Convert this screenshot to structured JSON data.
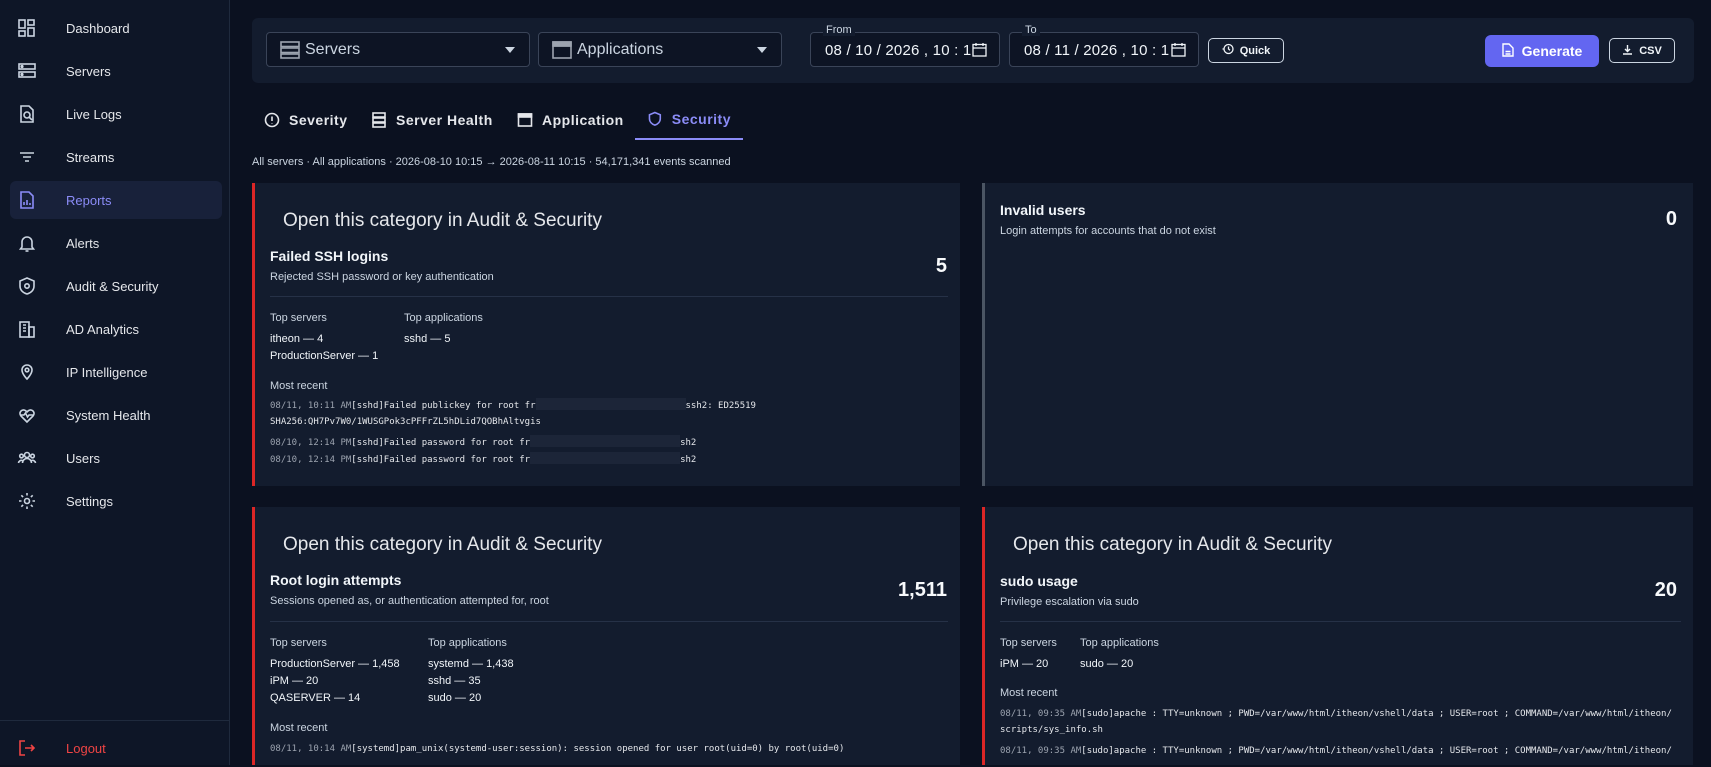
{
  "sidebar": {
    "items": [
      {
        "label": "Dashboard",
        "icon": "dashboard-icon"
      },
      {
        "label": "Servers",
        "icon": "servers-icon"
      },
      {
        "label": "Live Logs",
        "icon": "live-logs-icon"
      },
      {
        "label": "Streams",
        "icon": "streams-icon"
      },
      {
        "label": "Reports",
        "icon": "reports-icon",
        "active": true
      },
      {
        "label": "Alerts",
        "icon": "bell-icon"
      },
      {
        "label": "Audit & Security",
        "icon": "shield-icon"
      },
      {
        "label": "AD Analytics",
        "icon": "building-icon"
      },
      {
        "label": "IP Intelligence",
        "icon": "location-pin-icon"
      },
      {
        "label": "System Health",
        "icon": "heartbeat-icon"
      },
      {
        "label": "Users",
        "icon": "users-icon"
      },
      {
        "label": "Settings",
        "icon": "gear-icon"
      }
    ],
    "logout_label": "Logout"
  },
  "toolbar": {
    "servers_select": "Servers",
    "applications_select": "Applications",
    "from_label": "From",
    "from_value": "08 / 10 / 2026 ,  10 : 1",
    "to_label": "To",
    "to_value": "08 / 11 / 2026 ,  10 : 1",
    "quick_label": "Quick",
    "generate_label": "Generate",
    "csv_label": "CSV"
  },
  "tabs": [
    {
      "label": "Severity"
    },
    {
      "label": "Server Health"
    },
    {
      "label": "Application"
    },
    {
      "label": "Security",
      "active": true
    }
  ],
  "summary": "All servers · All applications · 2026-08-10 10:15 → 2026-08-11 10:15 · 54,171,341 events scanned",
  "cards": {
    "ssh": {
      "open_link": "Open this category in Audit & Security",
      "title": "Failed SSH logins",
      "subtitle": "Rejected SSH password or key authentication",
      "count": "5",
      "top_servers_h": "Top servers",
      "top_apps_h": "Top applications",
      "servers": [
        "itheon — 4",
        "ProductionServer — 1"
      ],
      "apps": [
        "sshd — 5"
      ],
      "most_recent_h": "Most recent",
      "log1_ts": "08/11, 10:11 AM",
      "log1_pre": "[sshd]Failed publickey for root fr",
      "log1_post": "ssh2: ED25519",
      "log1_line2": "SHA256:QH7Pv7W0/1WUSGPok3cPFFrZL5hDLid7QOBhAltvgis",
      "log2_ts": "08/10, 12:14 PM",
      "log2_pre": "[sshd]Failed password for root fr",
      "log2_post": "sh2",
      "log3_ts": "08/10, 12:14 PM",
      "log3_pre": "[sshd]Failed password for root fr",
      "log3_post": "sh2"
    },
    "invalid": {
      "title": "Invalid users",
      "subtitle": "Login attempts for accounts that do not exist",
      "count": "0"
    },
    "root": {
      "open_link": "Open this category in Audit & Security",
      "title": "Root login attempts",
      "subtitle": "Sessions opened as, or authentication attempted for, root",
      "count": "1,511",
      "top_servers_h": "Top servers",
      "top_apps_h": "Top applications",
      "servers": [
        "ProductionServer — 1,458",
        "iPM — 20",
        "QASERVER — 14"
      ],
      "apps": [
        "systemd — 1,438",
        "sshd — 35",
        "sudo — 20"
      ],
      "most_recent_h": "Most recent",
      "log1_ts": "08/11, 10:14 AM",
      "log1_msg": "[systemd]pam_unix(systemd-user:session): session opened for user root(uid=0) by root(uid=0)"
    },
    "sudo": {
      "open_link": "Open this category in Audit & Security",
      "title": "sudo usage",
      "subtitle": "Privilege escalation via sudo",
      "count": "20",
      "top_servers_h": "Top servers",
      "top_apps_h": "Top applications",
      "servers": [
        "iPM — 20"
      ],
      "apps": [
        "sudo — 20"
      ],
      "most_recent_h": "Most recent",
      "log1_ts": "08/11, 09:35 AM",
      "log1_msg": "[sudo]apache : TTY=unknown ; PWD=/var/www/html/itheon/vshell/data ; USER=root ; COMMAND=/var/www/html/itheon/",
      "log1_line2": "scripts/sys_info.sh",
      "log2_ts": "08/11, 09:35 AM",
      "log2_msg": "[sudo]apache : TTY=unknown ; PWD=/var/www/html/itheon/vshell/data ; USER=root ; COMMAND=/var/www/html/itheon/"
    }
  },
  "colors": {
    "accent": "#6366f1",
    "accent_text": "#8b8cf7",
    "danger": "#dc2626",
    "background": "#0b1120",
    "card": "#131c2e"
  }
}
